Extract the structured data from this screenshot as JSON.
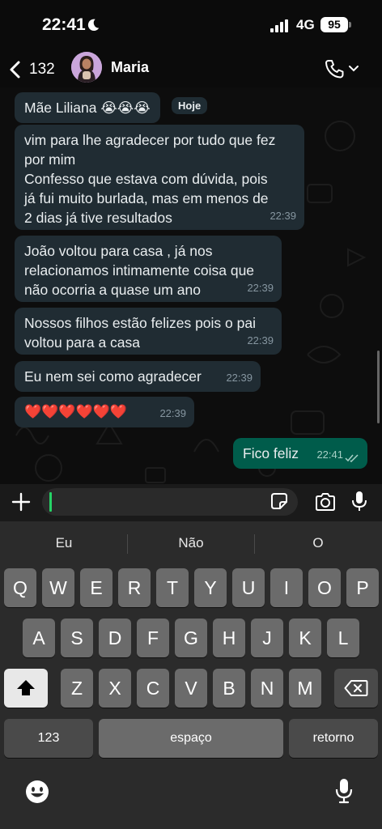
{
  "status_bar": {
    "time": "22:41",
    "network": "4G",
    "battery": "95"
  },
  "header": {
    "unread_count": "132",
    "contact_name": "Maria"
  },
  "chat": {
    "date_pill": "Hoje",
    "messages": [
      {
        "text": "Mãe Liliana 😭😭😭",
        "time": ""
      },
      {
        "text": "vim para lhe agradecer por tudo que fez\npor mim\nConfesso que estava com dúvida, pois\njá fui muito burlada, mas em menos de\n2 dias já tive resultados",
        "time": "22:39"
      },
      {
        "text": "João voltou para casa , já nos\nrelacionamos intimamente coisa que\nnão ocorria a quase um ano",
        "time": "22:39"
      },
      {
        "text": "Nossos filhos estão felizes pois o pai\nvoltou para a casa",
        "time": "22:39"
      },
      {
        "text": "Eu nem sei como agradecer",
        "time": "22:39"
      },
      {
        "text": "❤️❤️❤️❤️❤️❤️",
        "time": "22:39"
      },
      {
        "text": "Fico feliz",
        "time": "22:41",
        "outgoing": true
      }
    ]
  },
  "composer": {
    "value": ""
  },
  "keyboard": {
    "suggestions": [
      "Eu",
      "Não",
      "O"
    ],
    "row1": [
      "Q",
      "W",
      "E",
      "R",
      "T",
      "Y",
      "U",
      "I",
      "O",
      "P"
    ],
    "row2": [
      "A",
      "S",
      "D",
      "F",
      "G",
      "H",
      "J",
      "K",
      "L"
    ],
    "row3": [
      "Z",
      "X",
      "C",
      "V",
      "B",
      "N",
      "M"
    ],
    "numbers_label": "123",
    "space_label": "espaço",
    "return_label": "retorno"
  },
  "colors": {
    "incoming_bubble": "#202c33",
    "outgoing_bubble": "#005c4b",
    "accent": "#25d366"
  }
}
